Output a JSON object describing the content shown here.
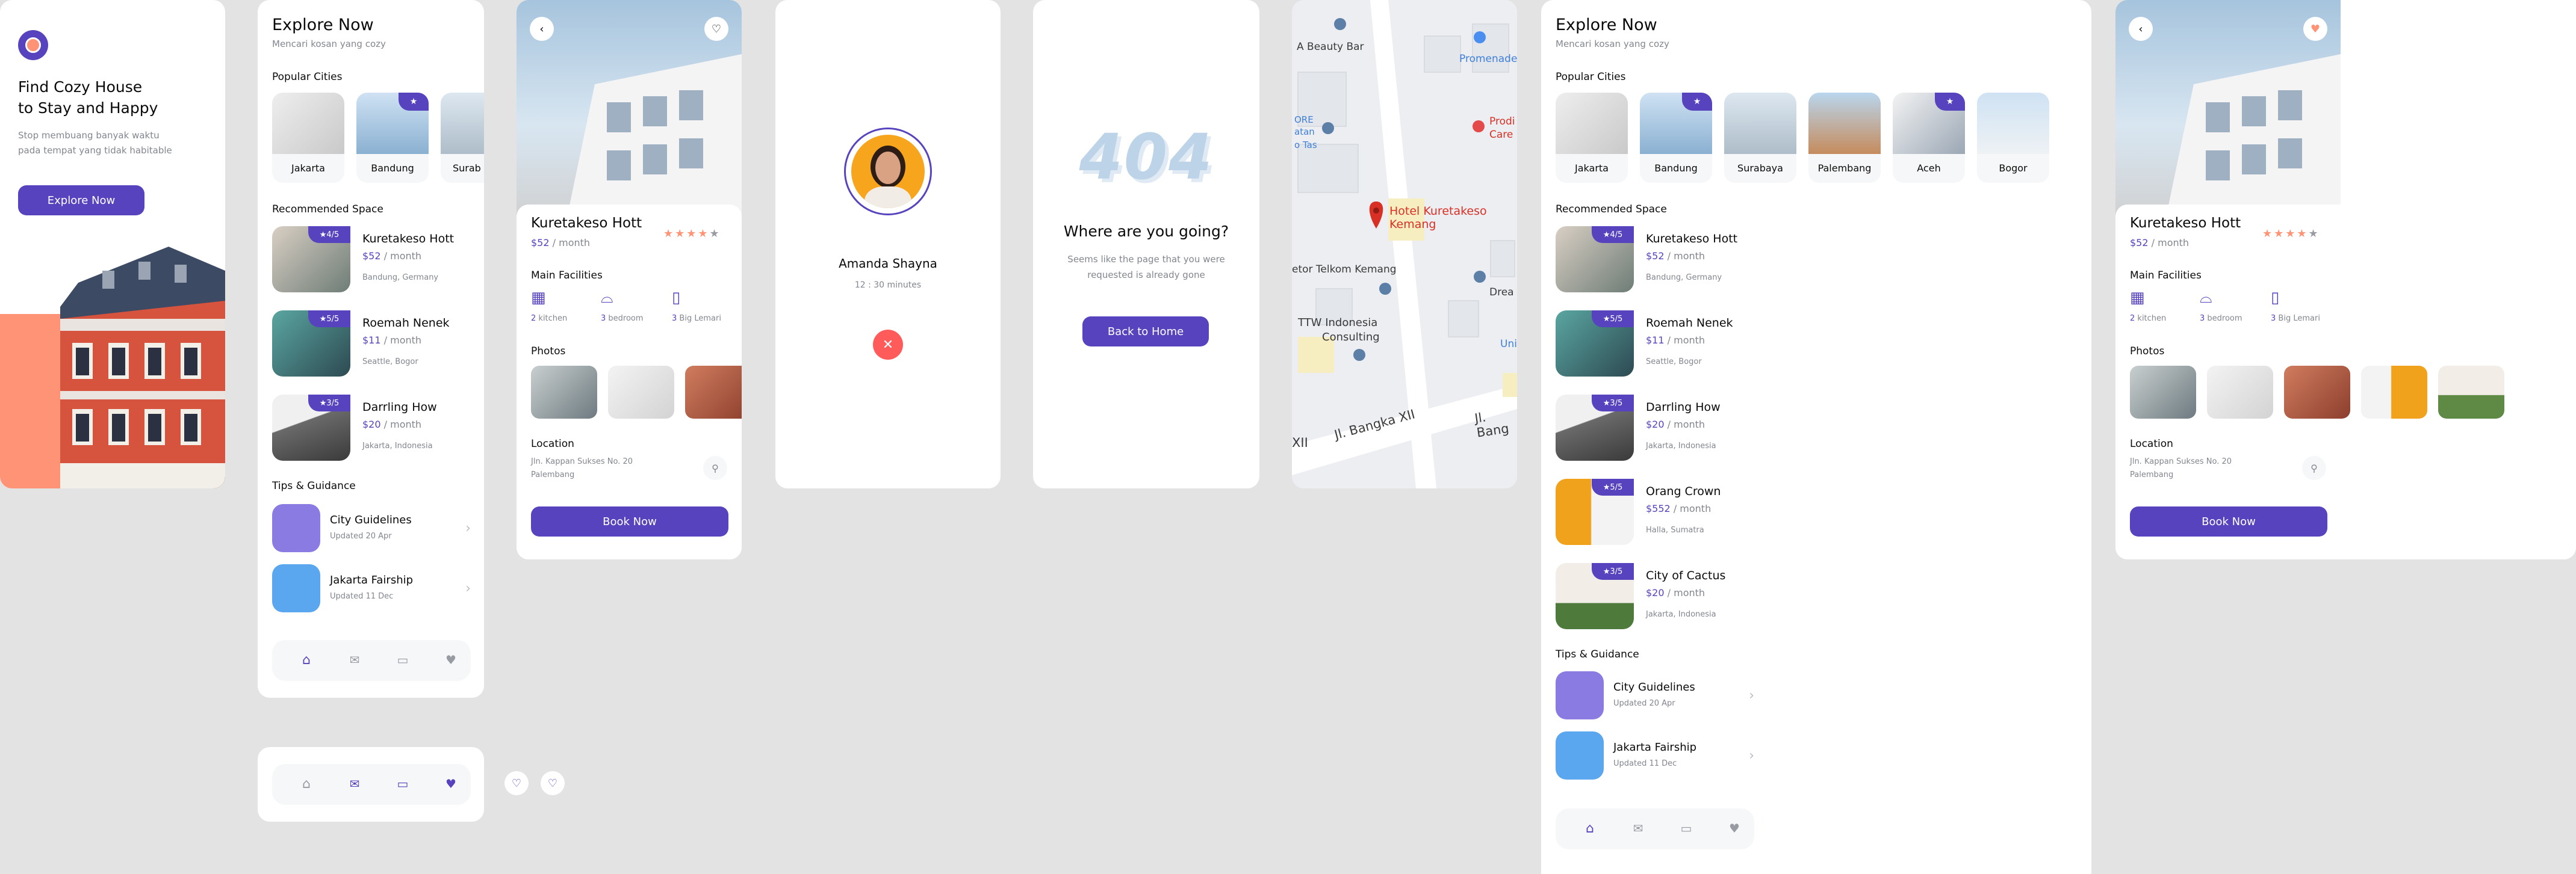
{
  "splash": {
    "title_line1": "Find Cozy House",
    "title_line2": "to Stay and Happy",
    "subtitle_line1": "Stop membuang banyak waktu",
    "subtitle_line2": "pada tempat yang tidak habitable",
    "cta": "Explore Now"
  },
  "home": {
    "title": "Explore Now",
    "subtitle": "Mencari kosan yang cozy",
    "popular_heading": "Popular Cities",
    "cities": [
      "Jakarta",
      "Bandung",
      "Surabaya",
      "Palembang",
      "Aceh",
      "Bogor"
    ],
    "city_cut_label": "Surab",
    "recommended_heading": "Recommended Space",
    "spaces": [
      {
        "name": "Kuretakeso Hott",
        "price": "$52",
        "per": "/ month",
        "location": "Bandung, Germany",
        "rating": "4/5"
      },
      {
        "name": "Roemah Nenek",
        "price": "$11",
        "per": "/ month",
        "location": "Seattle, Bogor",
        "rating": "5/5"
      },
      {
        "name": "Darrling How",
        "price": "$20",
        "per": "/ month",
        "location": "Jakarta, Indonesia",
        "rating": "3/5"
      },
      {
        "name": "Orang Crown",
        "price": "$552",
        "per": "/ month",
        "location": "Halla, Sumatra",
        "rating": "5/5"
      },
      {
        "name": "City of Cactus",
        "price": "$20",
        "per": "/ month",
        "location": "Jakarta, Indonesia",
        "rating": "3/5"
      }
    ],
    "tips_heading": "Tips & Guidance",
    "tips": [
      {
        "name": "City Guidelines",
        "date": "Updated 20 Apr"
      },
      {
        "name": "Jakarta Fairship",
        "date": "Updated 11 Dec"
      }
    ]
  },
  "detail": {
    "name": "Kuretakeso Hott",
    "price": "$52",
    "per": "/ month",
    "facilities_heading": "Main Facilities",
    "facilities": [
      {
        "count": "2",
        "label": "kitchen"
      },
      {
        "count": "3",
        "label": "bedroom"
      },
      {
        "count": "3",
        "label": "Big Lemari"
      }
    ],
    "photos_heading": "Photos",
    "location_heading": "Location",
    "address_line1": "Jln. Kappan Sukses No. 20",
    "address_line2": "Palembang",
    "book": "Book Now"
  },
  "call": {
    "name": "Amanda Shayna",
    "duration": "12 : 30 minutes"
  },
  "notfound": {
    "code": "404",
    "title": "Where are you going?",
    "message_line1": "Seems like the page that you were",
    "message_line2": "requested is already gone",
    "button": "Back to Home"
  },
  "map": {
    "labels": {
      "beauty_bar": "A Beauty Bar",
      "promenade": "Promenade",
      "prodi": "Prodi",
      "care": "Care",
      "ore": "ORE",
      "atan": "atan",
      "otas": "o Tas",
      "hotel1": "Hotel Kuretakeso",
      "hotel2": "Kemang",
      "telkom": "etor Telkom Kemang",
      "ttw1": "TTW Indonesia",
      "ttw2": "Consulting",
      "dream": "Drea",
      "uni": "Uni",
      "bangka": "Jl. Bangka XII",
      "bang2": "Jl. Bang",
      "xii": "XII"
    }
  },
  "colors": {
    "primary": "#5843be",
    "accent": "#ff9376",
    "text_gray": "#82868e",
    "bg": "#e3e3e3"
  }
}
